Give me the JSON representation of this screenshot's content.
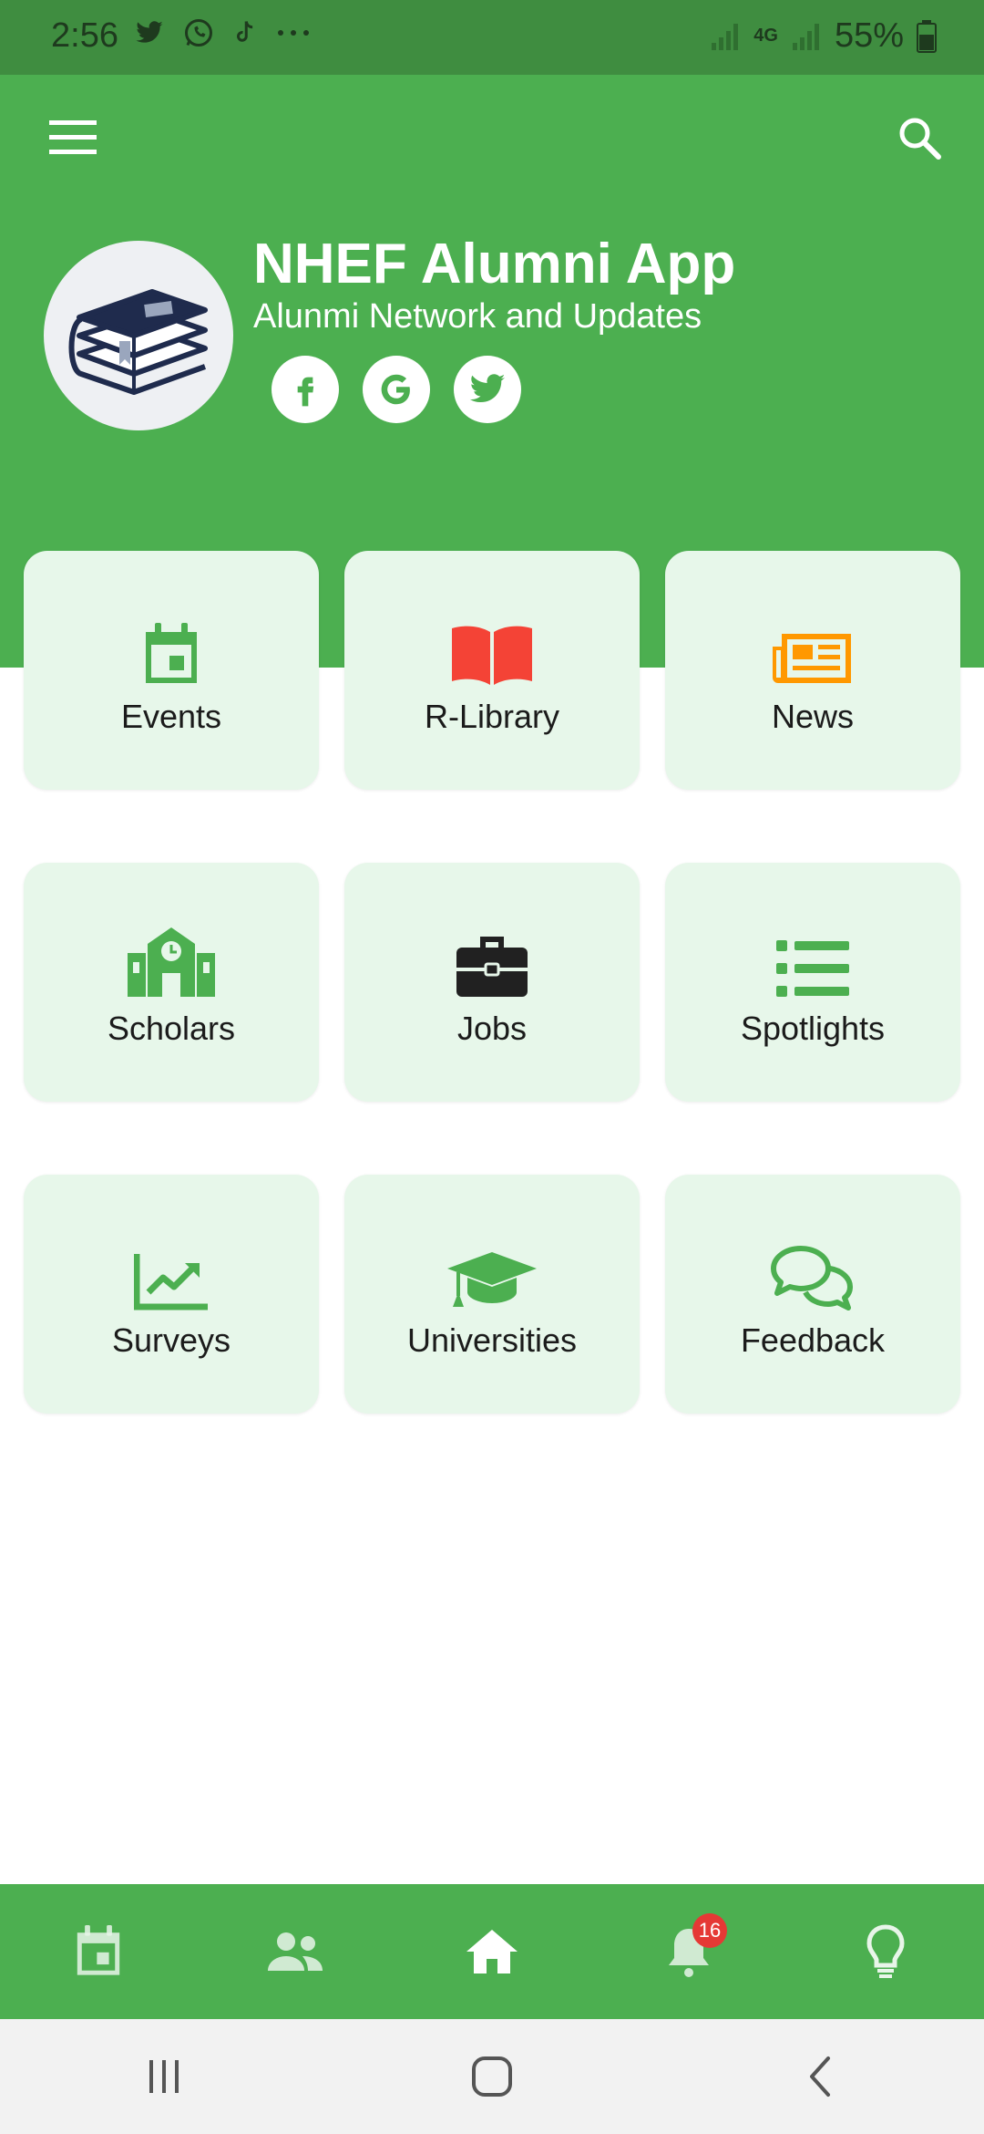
{
  "status_bar": {
    "time": "2:56",
    "battery": "55%",
    "network": "4G"
  },
  "header": {
    "title": "NHEF Alumni App",
    "subtitle": "Alunmi Network and Updates"
  },
  "tiles": [
    {
      "label": "Events",
      "icon": "calendar-icon",
      "color": "#4caf50"
    },
    {
      "label": "R-Library",
      "icon": "book-open-icon",
      "color": "#f44336"
    },
    {
      "label": "News",
      "icon": "newspaper-icon",
      "color": "#ff9800"
    },
    {
      "label": "Scholars",
      "icon": "school-icon",
      "color": "#4caf50"
    },
    {
      "label": "Jobs",
      "icon": "briefcase-icon",
      "color": "#212121"
    },
    {
      "label": "Spotlights",
      "icon": "list-icon",
      "color": "#4caf50"
    },
    {
      "label": "Surveys",
      "icon": "chart-line-icon",
      "color": "#4caf50"
    },
    {
      "label": "Universities",
      "icon": "graduation-cap-icon",
      "color": "#4caf50"
    },
    {
      "label": "Feedback",
      "icon": "chat-bubbles-icon",
      "color": "#4caf50"
    }
  ],
  "bottom_nav": {
    "notification_count": "16",
    "items": [
      "calendar-icon",
      "people-icon",
      "home-icon",
      "bell-icon",
      "lightbulb-icon"
    ]
  },
  "colors": {
    "primary": "#4caf50",
    "status_bar": "#3f8d40",
    "tile_bg": "#e7f7ea"
  }
}
